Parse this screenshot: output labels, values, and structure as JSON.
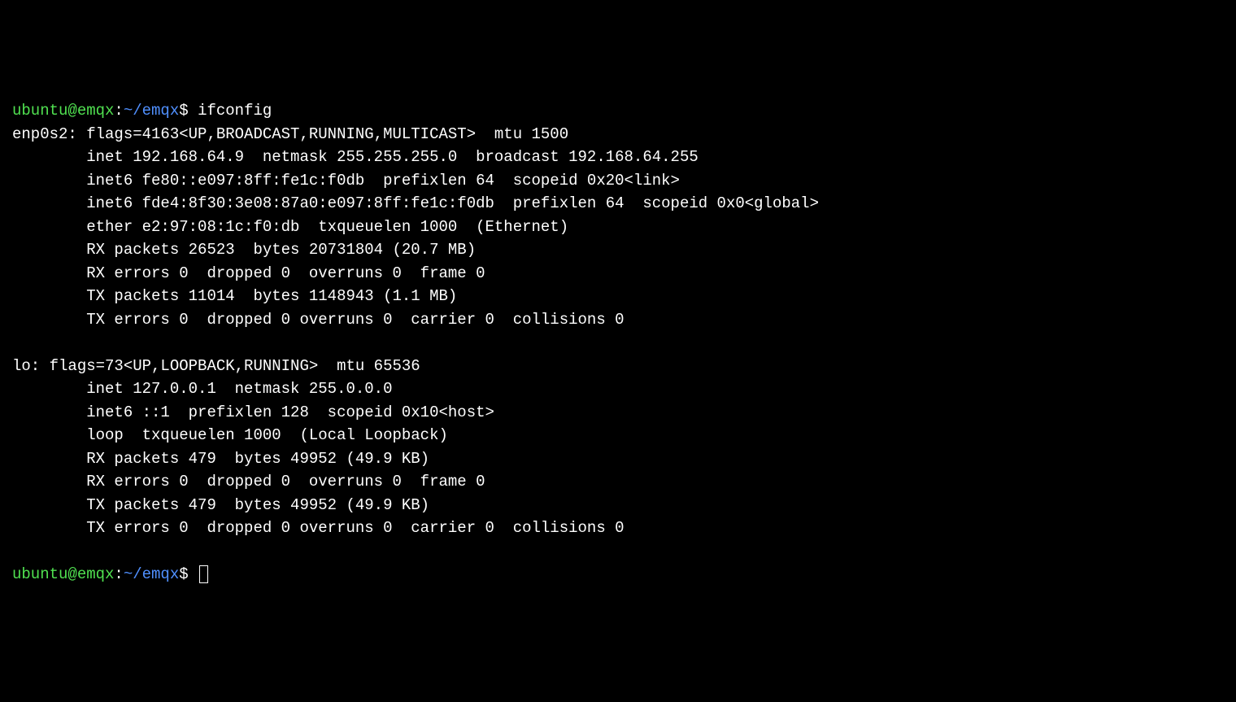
{
  "prompt": {
    "user_host": "ubuntu@emqx",
    "sep": ":",
    "path": "~/emqx",
    "dollar": "$"
  },
  "command": "ifconfig",
  "interfaces": [
    {
      "header": "enp0s2: flags=4163<UP,BROADCAST,RUNNING,MULTICAST>  mtu 1500",
      "lines": [
        "inet 192.168.64.9  netmask 255.255.255.0  broadcast 192.168.64.255",
        "inet6 fe80::e097:8ff:fe1c:f0db  prefixlen 64  scopeid 0x20<link>",
        "inet6 fde4:8f30:3e08:87a0:e097:8ff:fe1c:f0db  prefixlen 64  scopeid 0x0<global>",
        "ether e2:97:08:1c:f0:db  txqueuelen 1000  (Ethernet)",
        "RX packets 26523  bytes 20731804 (20.7 MB)",
        "RX errors 0  dropped 0  overruns 0  frame 0",
        "TX packets 11014  bytes 1148943 (1.1 MB)",
        "TX errors 0  dropped 0 overruns 0  carrier 0  collisions 0"
      ]
    },
    {
      "header": "lo: flags=73<UP,LOOPBACK,RUNNING>  mtu 65536",
      "lines": [
        "inet 127.0.0.1  netmask 255.0.0.0",
        "inet6 ::1  prefixlen 128  scopeid 0x10<host>",
        "loop  txqueuelen 1000  (Local Loopback)",
        "RX packets 479  bytes 49952 (49.9 KB)",
        "RX errors 0  dropped 0  overruns 0  frame 0",
        "TX packets 479  bytes 49952 (49.9 KB)",
        "TX errors 0  dropped 0 overruns 0  carrier 0  collisions 0"
      ]
    }
  ]
}
